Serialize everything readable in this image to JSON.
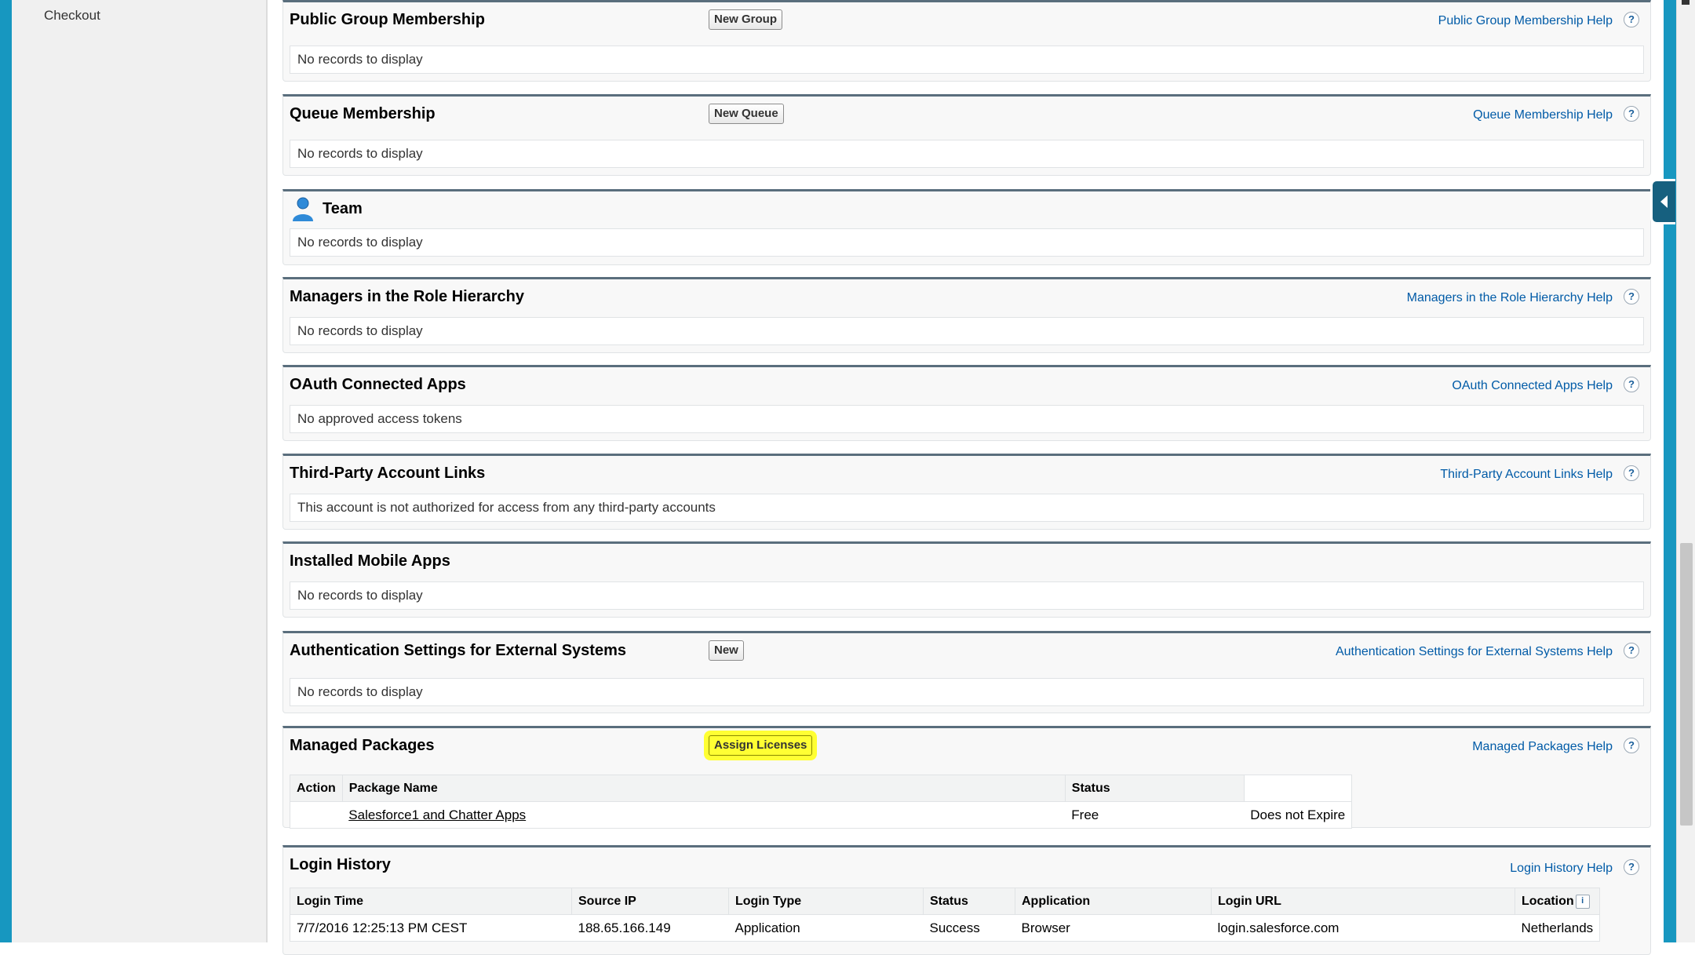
{
  "sidebar": {
    "checkout": "Checkout"
  },
  "icons": {
    "question": "?",
    "info": "i",
    "team": "person-icon",
    "collapse": "triangle-left-icon"
  },
  "panels": {
    "public_group": {
      "title": "Public Group Membership",
      "button": "New Group",
      "help": "Public Group Membership Help",
      "body": "No records to display"
    },
    "queue": {
      "title": "Queue Membership",
      "button": "New Queue",
      "help": "Queue Membership Help",
      "body": "No records to display"
    },
    "team": {
      "title": "Team",
      "body": "No records to display"
    },
    "managers": {
      "title": "Managers in the Role Hierarchy",
      "help": "Managers in the Role Hierarchy Help",
      "body": "No records to display"
    },
    "oauth": {
      "title": "OAuth Connected Apps",
      "help": "OAuth Connected Apps Help",
      "body": "No approved access tokens"
    },
    "third_party": {
      "title": "Third-Party Account Links",
      "help": "Third-Party Account Links Help",
      "body": "This account is not authorized for access from any third-party accounts"
    },
    "mobile": {
      "title": "Installed Mobile Apps",
      "body": "No records to display"
    },
    "auth_settings": {
      "title": "Authentication Settings for External Systems",
      "button": "New",
      "help": "Authentication Settings for External Systems Help",
      "body": "No records to display"
    },
    "managed_packages": {
      "title": "Managed Packages",
      "button": "Assign Licenses",
      "help": "Managed Packages Help",
      "columns": [
        "Action",
        "Package Name",
        "Status"
      ],
      "rows": [
        {
          "action": "",
          "package_name": "Salesforce1 and Chatter Apps",
          "status": "Free",
          "extra": "Does not Expire"
        }
      ]
    },
    "login_history": {
      "title": "Login History",
      "help": "Login History Help",
      "columns": [
        "Login Time",
        "Source IP",
        "Login Type",
        "Status",
        "Application",
        "Login URL",
        "Location"
      ],
      "rows": [
        {
          "login_time": "7/7/2016 12:25:13 PM CEST",
          "source_ip": "188.65.166.149",
          "login_type": "Application",
          "status": "Success",
          "application": "Browser",
          "login_url": "login.salesforce.com",
          "location": "Netherlands"
        }
      ]
    }
  },
  "colors": {
    "accent": "#1797c0",
    "link": "#015ba7",
    "highlight": "#ffff33",
    "panel_border": "#5a6e7d"
  }
}
